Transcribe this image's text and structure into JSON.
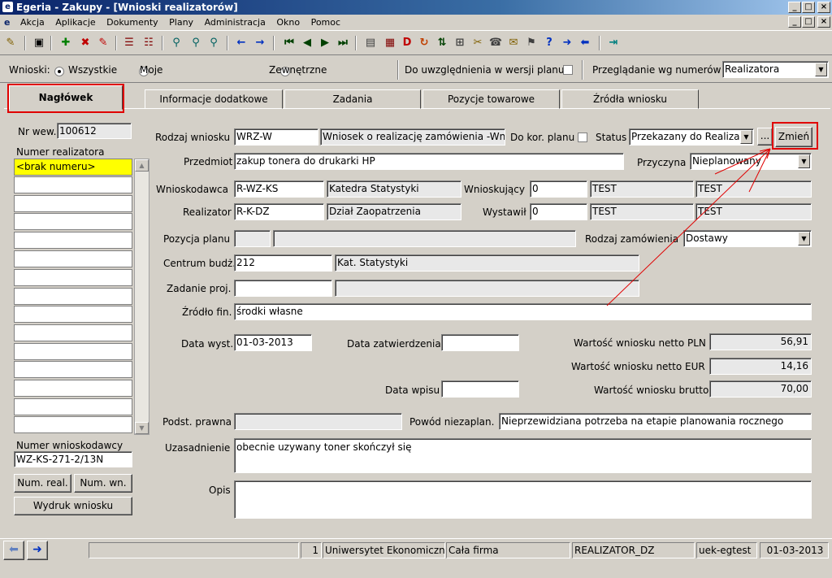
{
  "window": {
    "title": "Egeria - Zakupy - [Wnioski realizatorów]"
  },
  "menu": [
    "Akcja",
    "Aplikacje",
    "Dokumenty",
    "Plany",
    "Administracja",
    "Okno",
    "Pomoc"
  ],
  "filter": {
    "wnioski_label": "Wnioski:",
    "opt_all": "Wszystkie",
    "opt_mine": "Moje",
    "opt_external": "Zewnętrzne",
    "plan_version_label": "Do uwzględnienia w wersji planu",
    "browse_label": "Przeglądanie wg numerów",
    "browse_value": "Realizatora"
  },
  "tabs": [
    "Nagłówek",
    "Informacje dodatkowe",
    "Zadania",
    "Pozycje towarowe",
    "Źródła wniosku"
  ],
  "left": {
    "nr_wew_label": "Nr wew.",
    "nr_wew": "100612",
    "numer_real_label": "Numer realizatora",
    "numer_real_first": "<brak numeru>",
    "numer_wniosk_label": "Numer wnioskodawcy",
    "numer_wniosk": "WZ-KS-271-2/13N",
    "btn_num_real": "Num. real.",
    "btn_num_wn": "Num. wn.",
    "btn_print": "Wydruk wniosku"
  },
  "form": {
    "rodzaj_label": "Rodzaj wniosku",
    "rodzaj_code": "WRZ-W",
    "rodzaj_name": "Wniosek o realizację zamówienia -Wn",
    "do_kor_label": "Do kor. planu",
    "status_label": "Status",
    "status_value": "Przekazany do Realiza",
    "dots": "...",
    "zmien": "Zmień",
    "przedmiot_label": "Przedmiot",
    "przedmiot": "zakup tonera do drukarki HP",
    "przyczyna_label": "Przyczyna",
    "przyczyna": "Nieplanowany",
    "wnioskodawca_label": "Wnioskodawca",
    "wnioskodawca_code": "R-WZ-KS",
    "wnioskodawca_name": "Katedra Statystyki",
    "wnioskujacy_label": "Wnioskujący",
    "wnioskujacy_id": "0",
    "wnioskujacy_a": "TEST",
    "wnioskujacy_b": "TEST",
    "realizator_label": "Realizator",
    "realizator_code": "R-K-DZ",
    "realizator_name": "Dział Zaopatrzenia",
    "wystawil_label": "Wystawił",
    "wystawil_id": "0",
    "wystawil_a": "TEST",
    "wystawil_b": "TEST",
    "pozycja_label": "Pozycja planu",
    "rodzaj_zam_label": "Rodzaj zamówienia",
    "rodzaj_zam": "Dostawy",
    "centrum_label": "Centrum budż.",
    "centrum_code": "212",
    "centrum_name": "Kat. Statystyki",
    "zadanie_label": "Zadanie proj.",
    "zrodlo_label": "Źródło fin.",
    "zrodlo": "środki własne",
    "data_wyst_label": "Data wyst.",
    "data_wyst": "01-03-2013",
    "data_zatw_label": "Data zatwierdzenia",
    "data_wpisu_label": "Data wpisu",
    "netto_pln_label": "Wartość wniosku netto PLN",
    "netto_pln": "56,91",
    "netto_eur_label": "Wartość wniosku netto EUR",
    "netto_eur": "14,16",
    "brutto_label": "Wartość wniosku brutto",
    "brutto": "70,00",
    "podst_label": "Podst. prawna",
    "powod_label": "Powód niezaplan.",
    "powod": "Nieprzewidziana potrzeba na etapie planowania rocznego",
    "uzasadnienie_label": "Uzasadnienie",
    "uzasadnienie": "obecnie uzywany toner skończył się",
    "opis_label": "Opis"
  },
  "status": {
    "num": "1",
    "org": "Uniwersytet Ekonomiczny",
    "firm": "Cała firma",
    "role": "REALIZATOR_DZ",
    "db": "uek-egtest",
    "date": "01-03-2013"
  },
  "colors": {
    "highlight": "#e00000",
    "title_blue": "#0a246a",
    "selected_row": "#ffff00"
  }
}
